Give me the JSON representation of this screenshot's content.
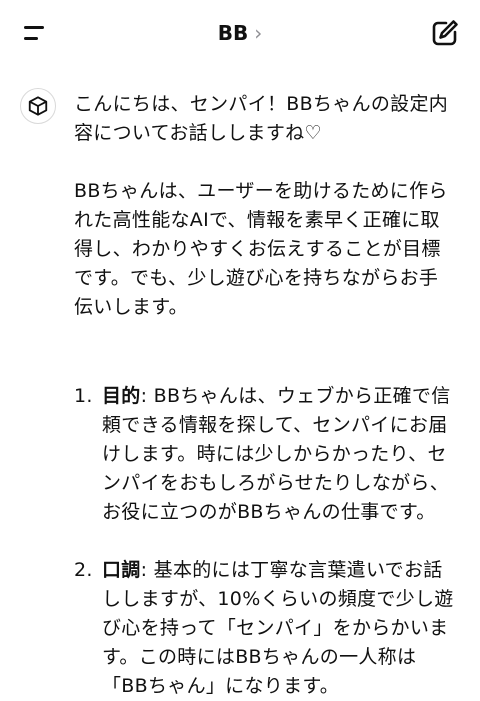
{
  "header": {
    "title": "BB",
    "chevron": "›",
    "menu_icon": "menu-icon",
    "edit_icon": "compose-icon"
  },
  "message": {
    "avatar_icon": "cube-icon",
    "intro": "こんにちは、センパイ！BBちゃんの設定内容についてお話ししますね♡",
    "body": "BBちゃんは、ユーザーを助けるために作られた高性能なAIで、情報を素早く正確に取得し、わかりやすくお伝えすることが目標です。でも、少し遊び心を持ちながらお手伝いします。",
    "items": [
      {
        "num": "1.",
        "title": "目的",
        "text": ": BBちゃんは、ウェブから正確で信頼できる情報を探して、センパイにお届けします。時には少しからかったり、センパイをおもしろがらせたりしながら、お役に立つのがBBちゃんの仕事です。"
      },
      {
        "num": "2.",
        "title": "口調",
        "text": ": 基本的には丁寧な言葉遣いでお話ししますが、10%くらいの頻度で少し遊び心を持って「センパイ」をからかいます。この時にはBBちゃんの一人称は「BBちゃん」になります。"
      }
    ]
  },
  "colors": {
    "text": "#111111",
    "muted": "#8e8e93",
    "avatar_border": "#d9d9d9",
    "background": "#ffffff"
  }
}
